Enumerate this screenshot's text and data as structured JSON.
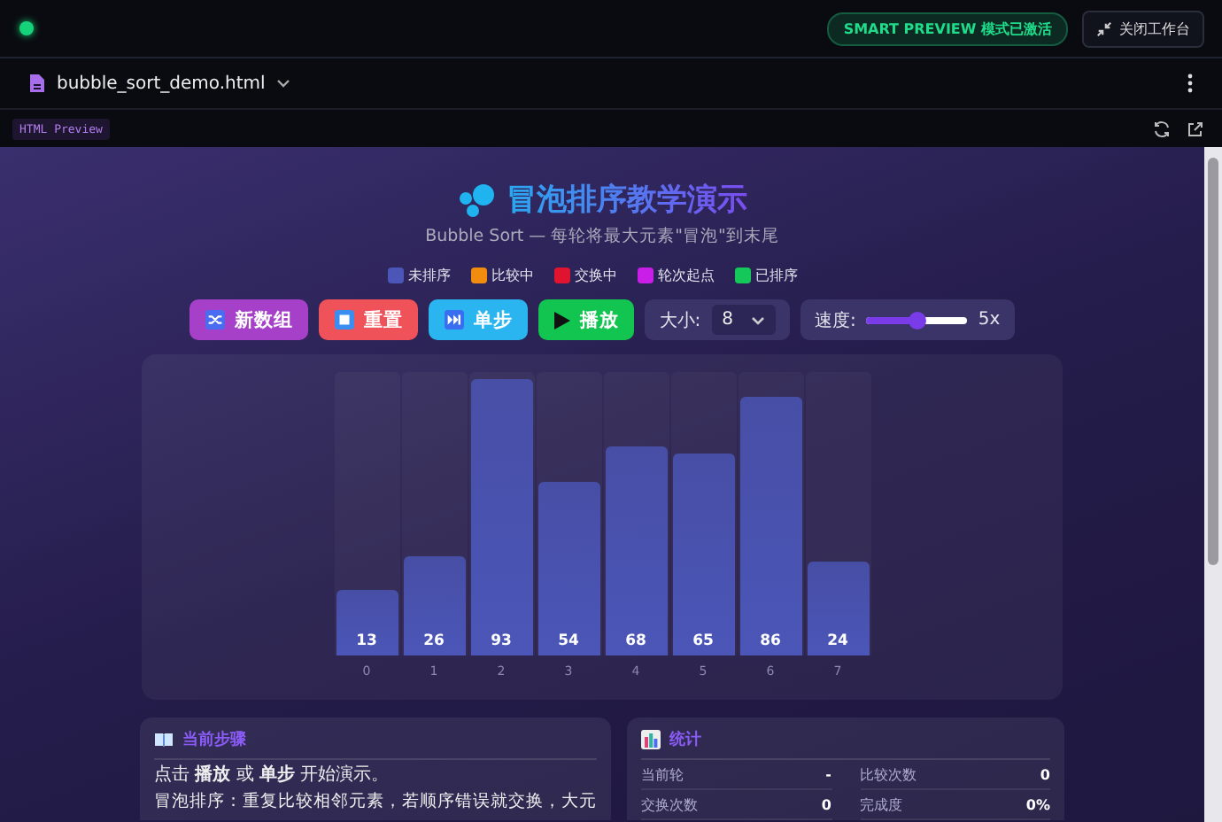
{
  "topbar": {
    "status_on": true,
    "badge": "SMART PREVIEW 模式已激活",
    "close_button": "关闭工作台"
  },
  "file_tab": {
    "name": "bubble_sort_demo.html"
  },
  "preview_bar": {
    "tag": "HTML Preview"
  },
  "app": {
    "title": "冒泡排序教学演示",
    "subtitle": "Bubble Sort — 每轮将最大元素\"冒泡\"到末尾",
    "legend": [
      {
        "label": "未排序",
        "color": "#4b56b8"
      },
      {
        "label": "比较中",
        "color": "#f28c0f"
      },
      {
        "label": "交换中",
        "color": "#e0142e"
      },
      {
        "label": "轮次起点",
        "color": "#c81ee8"
      },
      {
        "label": "已排序",
        "color": "#14c95a"
      }
    ],
    "buttons": [
      {
        "label": "新数组",
        "kind": "shuffle",
        "color": "#a640c8"
      },
      {
        "label": "重置",
        "kind": "stop",
        "color": "#f0525a"
      },
      {
        "label": "单步",
        "kind": "step",
        "color": "#2bb5f0"
      },
      {
        "label": "播放",
        "kind": "play",
        "color": "#12c450"
      }
    ],
    "size": {
      "label": "大小:",
      "value": "8"
    },
    "speed": {
      "label": "速度:",
      "level": 0.5,
      "reading": "5x"
    },
    "bars": [
      {
        "value": "13",
        "index": "0",
        "level": 0.23,
        "color": "#4b56b8"
      },
      {
        "value": "26",
        "index": "1",
        "level": 0.35,
        "color": "#4b56b8"
      },
      {
        "value": "93",
        "index": "2",
        "level": 0.975,
        "color": "#4b56b8"
      },
      {
        "value": "54",
        "index": "3",
        "level": 0.61,
        "color": "#4b56b8"
      },
      {
        "value": "68",
        "index": "4",
        "level": 0.74,
        "color": "#4b56b8"
      },
      {
        "value": "65",
        "index": "5",
        "level": 0.71,
        "color": "#4b56b8"
      },
      {
        "value": "86",
        "index": "6",
        "level": 0.91,
        "color": "#4b56b8"
      },
      {
        "value": "24",
        "index": "7",
        "level": 0.33,
        "color": "#4b56b8"
      }
    ],
    "step_panel": {
      "title": "当前步骤",
      "lines": [
        "点击 **播放** 或 **单步** 开始演示。",
        "冒泡排序：重复比较相邻元素，若顺序错误就交换，大元"
      ]
    },
    "stats_panel": {
      "title": "统计",
      "items": [
        {
          "label": "当前轮",
          "value": "-"
        },
        {
          "label": "比较次数",
          "value": "0"
        },
        {
          "label": "交换次数",
          "value": "0"
        },
        {
          "label": "完成度",
          "value": "0%"
        }
      ]
    }
  }
}
